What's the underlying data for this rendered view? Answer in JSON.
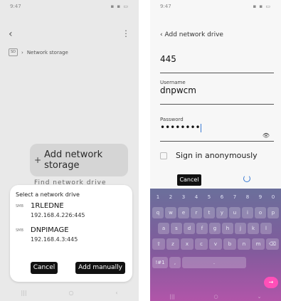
{
  "left": {
    "status": {
      "time": "9:47",
      "icons": "▪ ▪ ▭"
    },
    "breadcrumb": {
      "device_icon": "sd-card-icon",
      "text": "Network storage"
    },
    "add_card": {
      "label": "Add network storage"
    },
    "behind_text": "Find network drive",
    "sheet": {
      "title": "Select a network drive",
      "drives": [
        {
          "type": "SMB",
          "name": "1RLEDNE",
          "address": "192.168.4.226:445"
        },
        {
          "type": "SMB",
          "name": "DNPIMAGE",
          "address": "192.168.4.3:445"
        }
      ],
      "cancel": "Cancel",
      "add_manually": "Add manually"
    }
  },
  "right": {
    "status": {
      "time": "9:47",
      "icons": "▪ ▪ ▭"
    },
    "header": "Add network drive",
    "port": {
      "value": "445"
    },
    "username": {
      "label": "Username",
      "value": "dnpwcm"
    },
    "password": {
      "label": "Password",
      "value": "••••••••"
    },
    "anonymous": {
      "label": "Sign in anonymously"
    },
    "cancel": "Cancel",
    "keyboard": {
      "row1": [
        "1",
        "2",
        "3",
        "4",
        "5",
        "6",
        "7",
        "8",
        "9",
        "0"
      ],
      "row2": [
        "q",
        "w",
        "e",
        "r",
        "t",
        "y",
        "u",
        "i",
        "o",
        "p"
      ],
      "row3": [
        "a",
        "s",
        "d",
        "f",
        "g",
        "h",
        "j",
        "k",
        "l"
      ],
      "row4": [
        "⇧",
        "z",
        "x",
        "c",
        "v",
        "b",
        "n",
        "m",
        "⌫"
      ],
      "row5": [
        "!#1",
        ",",
        ".",
        "→"
      ]
    }
  },
  "colors": {
    "accent": "#3a7bd5",
    "keyboard_action": "#ff4fb8",
    "button": "#111111"
  }
}
